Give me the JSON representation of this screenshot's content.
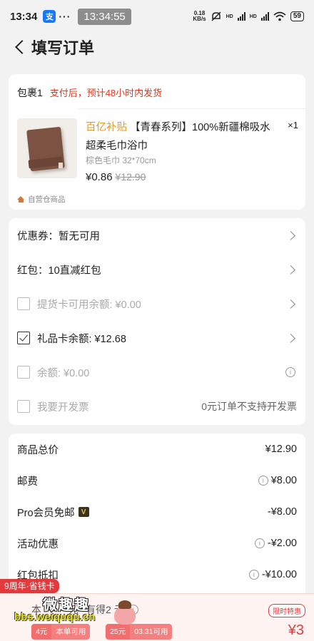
{
  "status_bar": {
    "time": "13:34",
    "app_icon_glyph": "支",
    "more": "···",
    "clock_pill": "13:34:55",
    "net_speed_value": "0.18",
    "net_speed_unit": "KB/s",
    "network_1": "HD",
    "network_2": "HD",
    "battery": "59"
  },
  "nav": {
    "title": "填写订单"
  },
  "package": {
    "label": "包裹1",
    "note": "支付后，预计48小时内发货",
    "product": {
      "badge": "百亿补贴",
      "title": "【青春系列】100%新疆棉吸水超柔毛巾浴巾",
      "quantity": "×1",
      "spec": "棕色毛巾 32*70cm",
      "price": "¥0.86",
      "original_price": "¥12.90"
    },
    "store_tag": "自营仓商品"
  },
  "options": {
    "coupon": {
      "label": "优惠券：暂无可用"
    },
    "red_packet": {
      "label": "红包：10直减红包"
    },
    "pickup_card": {
      "label": "提货卡可用余额: ¥0.00",
      "checked": false,
      "disabled": true
    },
    "gift_card": {
      "label": "礼品卡余额: ¥12.68",
      "checked": true,
      "disabled": false
    },
    "balance": {
      "label": "余额: ¥0.00",
      "checked": false,
      "disabled": true
    },
    "invoice": {
      "label": "我要开发票",
      "right": "0元订单不支持开发票",
      "checked": false,
      "disabled": true
    }
  },
  "summary": {
    "rows": [
      {
        "label": "商品总价",
        "value": "¥12.90",
        "info": false
      },
      {
        "label": "邮费",
        "value": "¥8.00",
        "info": true
      },
      {
        "label": "Pro会员免邮",
        "value": "-¥8.00",
        "info": false,
        "vip": "V"
      },
      {
        "label": "活动优惠",
        "value": "-¥2.00",
        "info": true
      },
      {
        "label": "红包抵扣",
        "value": "-¥10.00",
        "info": true
      }
    ]
  },
  "bottom": {
    "promo_tag": "9周年·省钱卡",
    "line1_prefix": "本",
    "line1_mid": "元",
    "line1_suffix": "有得2",
    "line1_end": "元",
    "limited_tag": "限时特惠",
    "coupons": [
      {
        "amount": "4元",
        "desc": "本单可用"
      },
      {
        "amount": "25元",
        "desc": "03.31可用"
      }
    ],
    "total": "¥3"
  },
  "watermark": {
    "top": "微趣趣",
    "bottom": "bbs.weiququ.cn"
  },
  "colors": {
    "accent_red": "#e4393c",
    "badge_orange": "#e7961e",
    "page_bg": "#f2f2f2"
  }
}
